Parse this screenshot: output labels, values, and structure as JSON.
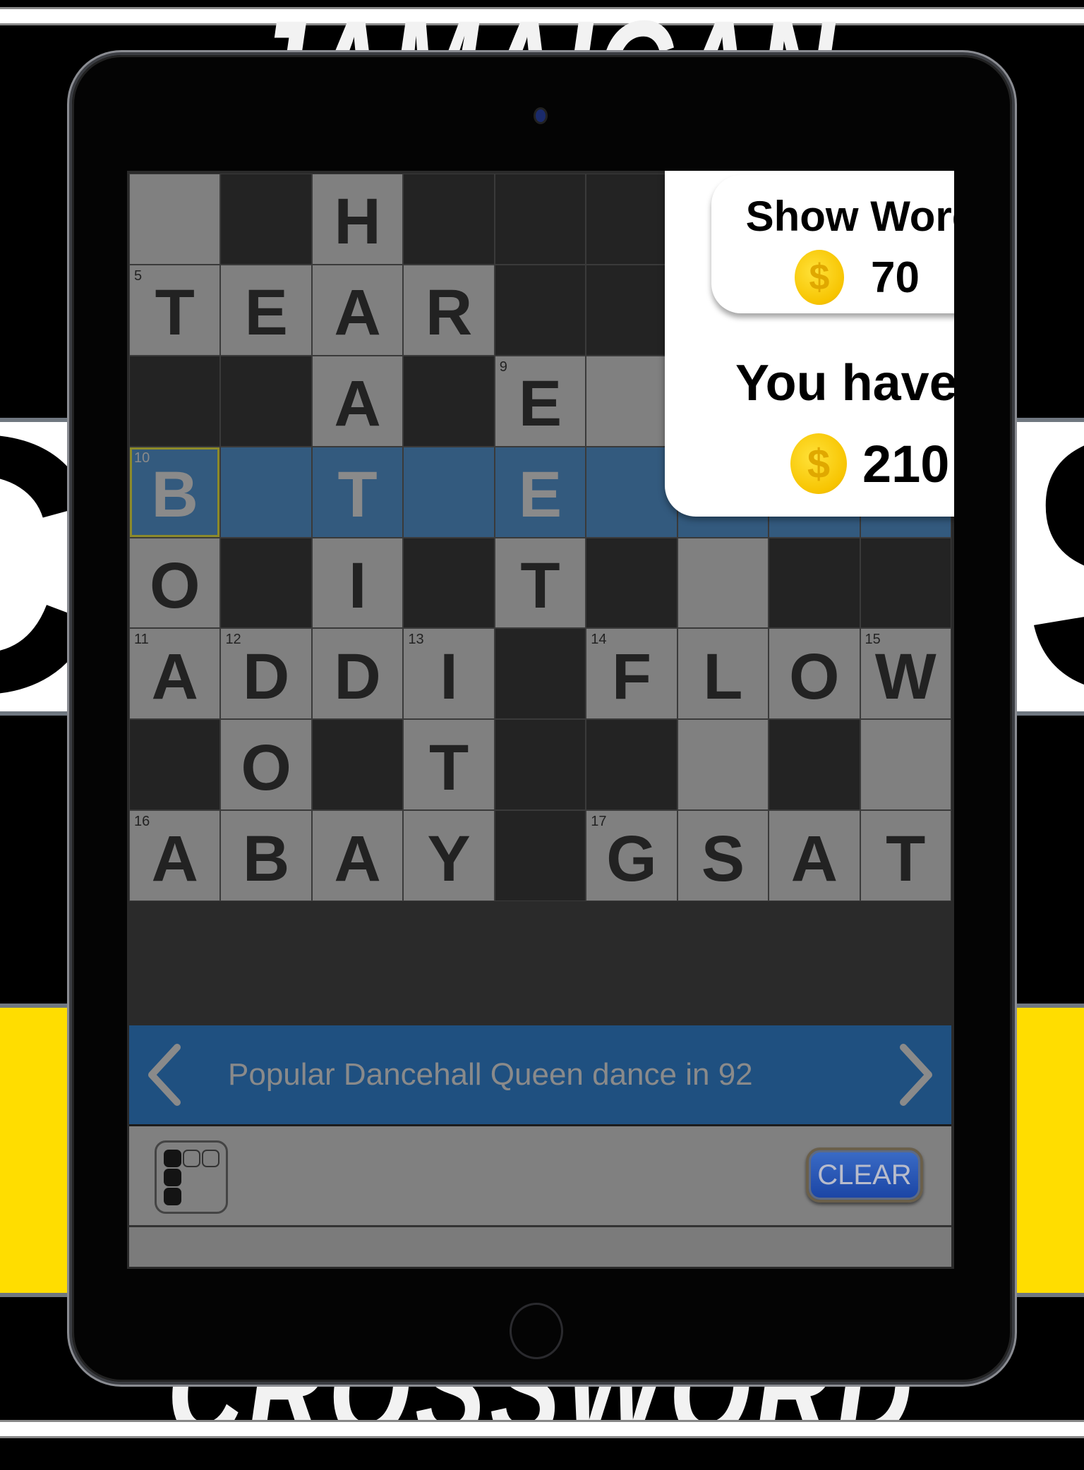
{
  "background": {
    "title_top": "JAMAICAN",
    "title_bottom": "CROSSWORD",
    "left_glyph": "C",
    "right_glyph": "S",
    "colors": {
      "yellow": "#ffdd00",
      "white": "#ffffff",
      "black": "#000000"
    }
  },
  "grid": {
    "rows": 8,
    "cols": 9,
    "cells": [
      [
        {
          "t": "w"
        },
        {
          "t": "b"
        },
        {
          "t": "w",
          "l": "H"
        },
        {
          "t": "b"
        },
        {
          "t": "b"
        },
        {
          "t": "b"
        },
        {
          "t": "b"
        },
        {
          "t": "b"
        },
        {
          "t": "b"
        }
      ],
      [
        {
          "t": "w",
          "l": "T",
          "n": "5"
        },
        {
          "t": "w",
          "l": "E"
        },
        {
          "t": "w",
          "l": "A"
        },
        {
          "t": "w",
          "l": "R"
        },
        {
          "t": "b"
        },
        {
          "t": "b"
        },
        {
          "t": "b"
        },
        {
          "t": "b"
        },
        {
          "t": "w"
        }
      ],
      [
        {
          "t": "b"
        },
        {
          "t": "b"
        },
        {
          "t": "w",
          "l": "A"
        },
        {
          "t": "b"
        },
        {
          "t": "w",
          "l": "E",
          "n": "9"
        },
        {
          "t": "w"
        },
        {
          "t": "w"
        },
        {
          "t": "w"
        },
        {
          "t": "w"
        }
      ],
      [
        {
          "t": "a",
          "l": "B",
          "n": "10",
          "sel": true
        },
        {
          "t": "a"
        },
        {
          "t": "a",
          "l": "T"
        },
        {
          "t": "a"
        },
        {
          "t": "a",
          "l": "E"
        },
        {
          "t": "a"
        },
        {
          "t": "a"
        },
        {
          "t": "a"
        },
        {
          "t": "a"
        }
      ],
      [
        {
          "t": "w",
          "l": "O"
        },
        {
          "t": "b"
        },
        {
          "t": "w",
          "l": "I"
        },
        {
          "t": "b"
        },
        {
          "t": "w",
          "l": "T"
        },
        {
          "t": "b"
        },
        {
          "t": "w"
        },
        {
          "t": "b"
        },
        {
          "t": "b"
        }
      ],
      [
        {
          "t": "w",
          "l": "A",
          "n": "11"
        },
        {
          "t": "w",
          "l": "D",
          "n": "12"
        },
        {
          "t": "w",
          "l": "D"
        },
        {
          "t": "w",
          "l": "I",
          "n": "13"
        },
        {
          "t": "b"
        },
        {
          "t": "w",
          "l": "F",
          "n": "14"
        },
        {
          "t": "w",
          "l": "L"
        },
        {
          "t": "w",
          "l": "O"
        },
        {
          "t": "w",
          "l": "W",
          "n": "15"
        }
      ],
      [
        {
          "t": "b"
        },
        {
          "t": "w",
          "l": "O"
        },
        {
          "t": "b"
        },
        {
          "t": "w",
          "l": "T"
        },
        {
          "t": "b"
        },
        {
          "t": "b"
        },
        {
          "t": "w"
        },
        {
          "t": "b"
        },
        {
          "t": "w"
        }
      ],
      [
        {
          "t": "w",
          "l": "A",
          "n": "16"
        },
        {
          "t": "w",
          "l": "B"
        },
        {
          "t": "w",
          "l": "A"
        },
        {
          "t": "w",
          "l": "Y"
        },
        {
          "t": "b"
        },
        {
          "t": "w",
          "l": "G",
          "n": "17"
        },
        {
          "t": "w",
          "l": "S"
        },
        {
          "t": "w",
          "l": "A"
        },
        {
          "t": "w",
          "l": "T"
        }
      ]
    ]
  },
  "clue": {
    "text": "Popular Dancehall Queen dance in 92",
    "prev_icon": "chevron-left-icon",
    "next_icon": "chevron-right-icon"
  },
  "toolbar": {
    "layout_icon": "grid-layout-icon",
    "clear_label": "CLEAR"
  },
  "popup": {
    "show_word_label": "Show Word",
    "show_word_cost": "70",
    "you_have_label": "You have",
    "balance": "210",
    "coin_icon": "$"
  }
}
